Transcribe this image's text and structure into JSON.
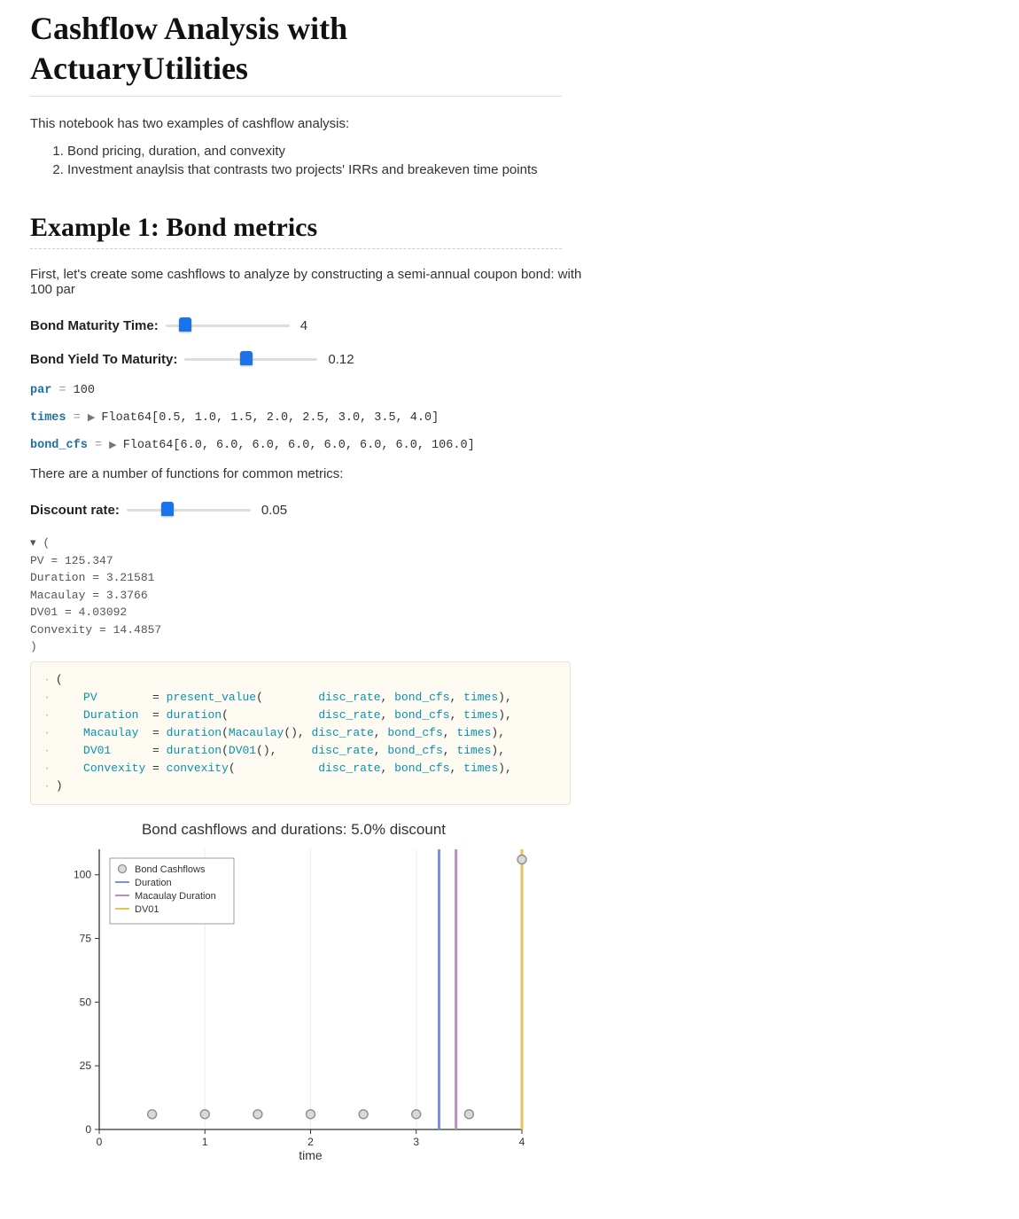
{
  "title": "Cashflow Analysis with ActuaryUtilities",
  "intro": "This notebook has two examples of cashflow analysis:",
  "intro_items": [
    "Bond pricing, duration, and convexity",
    "Investment anaylsis that contrasts two projects' IRRs and breakeven time points"
  ],
  "section1": {
    "heading": "Example 1: Bond metrics",
    "para1": "First, let's create some cashflows to analyze by constructing a semi-annual coupon bond: with 100 par",
    "slider_maturity": {
      "label": "Bond Maturity Time:",
      "value": "4",
      "pos_pct": 11
    },
    "slider_ytm": {
      "label": "Bond Yield To Maturity:",
      "value": "0.12",
      "pos_pct": 42
    },
    "par_line": {
      "var": "par",
      "eq": " = ",
      "val": "100"
    },
    "times_line": {
      "var": "times",
      "eq": " = ",
      "tri": "▶",
      "val": "Float64[0.5, 1.0, 1.5, 2.0, 2.5, 3.0, 3.5, 4.0]"
    },
    "cfs_line": {
      "var": "bond_cfs",
      "eq": " = ",
      "tri": "▶",
      "val": "Float64[6.0, 6.0, 6.0, 6.0, 6.0, 6.0, 6.0, 106.0]"
    },
    "para2": "There are a number of functions for common metrics:",
    "slider_disc": {
      "label": "Discount rate:",
      "value": "0.05",
      "pos_pct": 28
    },
    "output_tuple": {
      "open": "▾ (",
      "lines": [
        "  PV = 125.347",
        "  Duration = 3.21581",
        "  Macaulay = 3.3766",
        "  DV01 = 4.03092",
        "  Convexity = 14.4857"
      ],
      "close": ")"
    },
    "code_block": [
      "(",
      "    PV        = present_value(        disc_rate, bond_cfs, times),",
      "    Duration  = duration(             disc_rate, bond_cfs, times),",
      "    Macaulay  = duration(Macaulay(),  disc_rate, bond_cfs, times),",
      "    DV01      = duration(DV01(),      disc_rate, bond_cfs, times),",
      "    Convexity = convexity(            disc_rate, bond_cfs, times),",
      ")"
    ]
  },
  "chart_data": {
    "type": "scatter",
    "title": "Bond cashflows and durations: 5.0% discount",
    "xlabel": "time",
    "ylabel": "",
    "xlim": [
      0,
      4
    ],
    "ylim": [
      0,
      110
    ],
    "xticks": [
      0,
      1,
      2,
      3,
      4
    ],
    "yticks": [
      0,
      25,
      50,
      75,
      100
    ],
    "series": [
      {
        "name": "Bond Cashflows",
        "type": "scatter",
        "color": "#8f8f8f",
        "x": [
          0.5,
          1.0,
          1.5,
          2.0,
          2.5,
          3.0,
          3.5,
          4.0
        ],
        "y": [
          6.0,
          6.0,
          6.0,
          6.0,
          6.0,
          6.0,
          6.0,
          106.0
        ]
      },
      {
        "name": "Duration",
        "type": "vline",
        "color": "#7b8fe8",
        "x": 3.21581
      },
      {
        "name": "Macaulay Duration",
        "type": "vline",
        "color": "#b98cc6",
        "x": 3.3766
      },
      {
        "name": "DV01",
        "type": "vline",
        "color": "#e6c15a",
        "x": 4.03092
      }
    ],
    "legend": {
      "position": "top-left",
      "items": [
        {
          "label": "Bond Cashflows",
          "marker": "circle",
          "color": "#8f8f8f"
        },
        {
          "label": "Duration",
          "marker": "line",
          "color": "#7b8fe8"
        },
        {
          "label": "Macaulay Duration",
          "marker": "line",
          "color": "#b98cc6"
        },
        {
          "label": "DV01",
          "marker": "line",
          "color": "#e6c15a"
        }
      ]
    }
  }
}
